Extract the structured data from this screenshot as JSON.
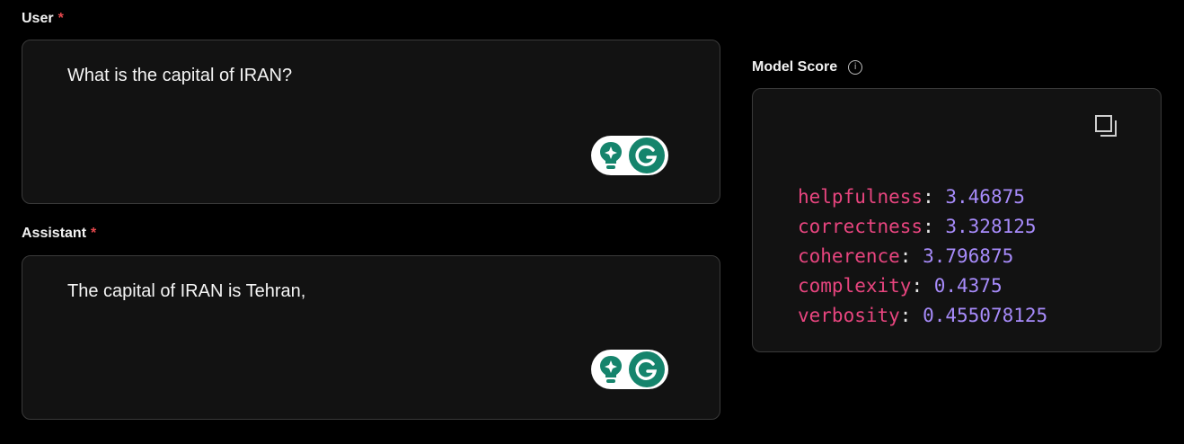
{
  "user_field": {
    "label": "User",
    "required_mark": "*",
    "value": "What is the capital of IRAN?"
  },
  "assistant_field": {
    "label": "Assistant",
    "required_mark": "*",
    "value": "The capital of IRAN is Tehran,"
  },
  "model_score": {
    "label": "Model Score",
    "info_icon": "info-icon",
    "copy_icon": "copy-icon",
    "scores": [
      {
        "key": "helpfulness",
        "value": "3.46875"
      },
      {
        "key": "correctness",
        "value": "3.328125"
      },
      {
        "key": "coherence",
        "value": "3.796875"
      },
      {
        "key": "complexity",
        "value": "0.4375"
      },
      {
        "key": "verbosity",
        "value": "0.455078125"
      }
    ]
  },
  "grammarly_widget": {
    "icons": [
      "lightbulb-sparkle-icon",
      "grammarly-g-icon"
    ]
  },
  "colors": {
    "background": "#000000",
    "panel": "#121212",
    "border": "#3a3a3a",
    "required": "#e5484d",
    "score_key": "#e8457f",
    "score_value": "#a78bfa",
    "grammarly": "#15846c"
  }
}
